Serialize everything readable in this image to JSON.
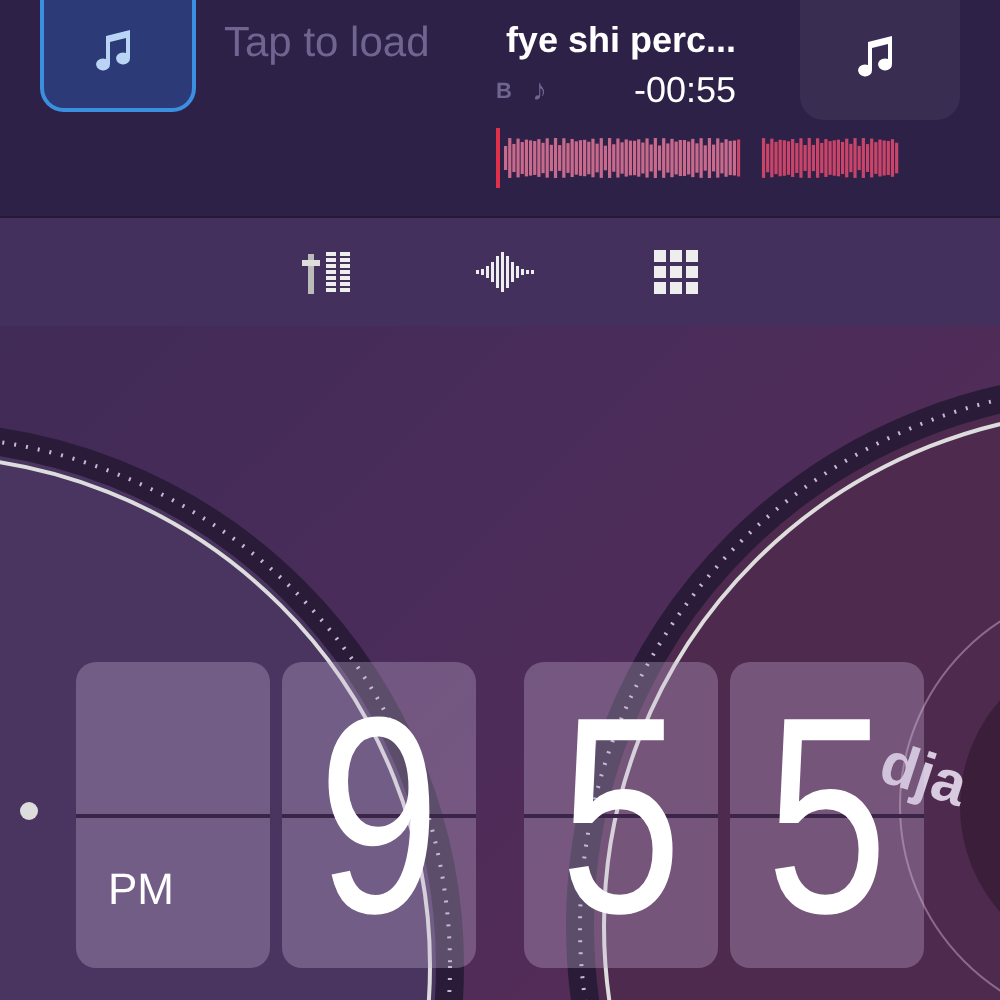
{
  "deck_a": {
    "status": "Tap to load"
  },
  "deck_b": {
    "title": "fye shi perc...",
    "key": "B",
    "note": "♪",
    "time": "-00:55"
  },
  "clock": {
    "period": "PM",
    "digits": [
      "9",
      "5",
      "5"
    ]
  },
  "turntable_b": {
    "label": "dja"
  }
}
